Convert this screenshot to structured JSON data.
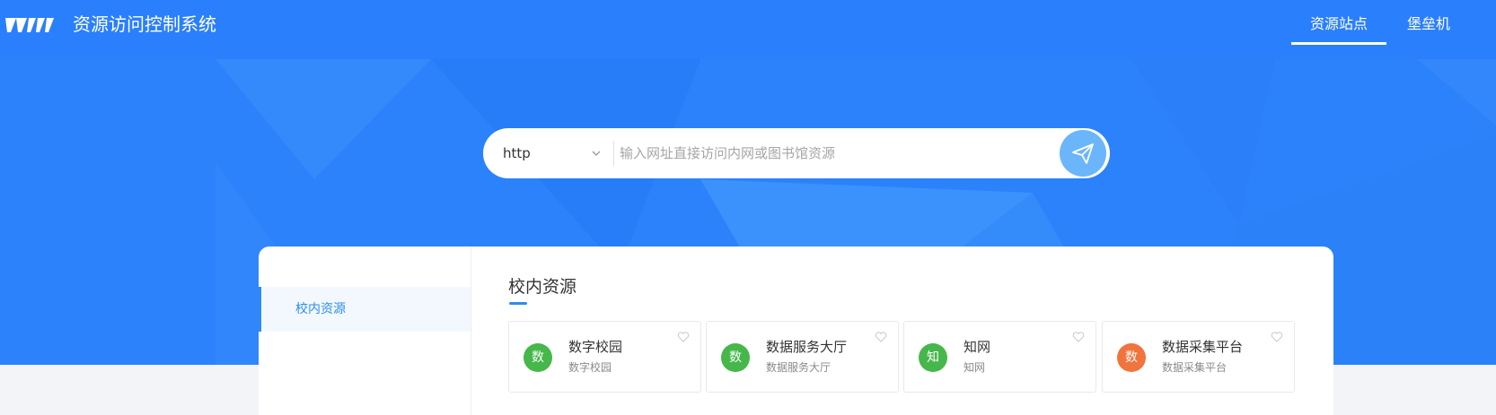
{
  "header": {
    "app_title": "资源访问控制系统",
    "logo_icon": "logo-icon",
    "nav": [
      {
        "label": "资源站点",
        "active": true
      },
      {
        "label": "堡垒机",
        "active": false
      }
    ]
  },
  "search": {
    "protocol": "http",
    "placeholder": "输入网址直接访问内网或图书馆资源",
    "value": "",
    "submit_icon": "paper-plane-icon"
  },
  "sidebar": {
    "items": [
      {
        "label": "校内资源",
        "active": true
      }
    ]
  },
  "main": {
    "section_title": "校内资源",
    "cards": [
      {
        "badge": "数",
        "name": "数字校园",
        "sub": "数字校园",
        "color": "#46b74a"
      },
      {
        "badge": "数",
        "name": "数据服务大厅",
        "sub": "数据服务大厅",
        "color": "#46b74a"
      },
      {
        "badge": "知",
        "name": "知网",
        "sub": "知网",
        "color": "#46b74a"
      },
      {
        "badge": "数",
        "name": "数据采集平台",
        "sub": "数据采集平台",
        "color": "#f0743d"
      }
    ]
  },
  "colors": {
    "hero_bg": "#2b82fb",
    "accent": "#2d8cf0",
    "search_button": "#6bb6fb"
  }
}
